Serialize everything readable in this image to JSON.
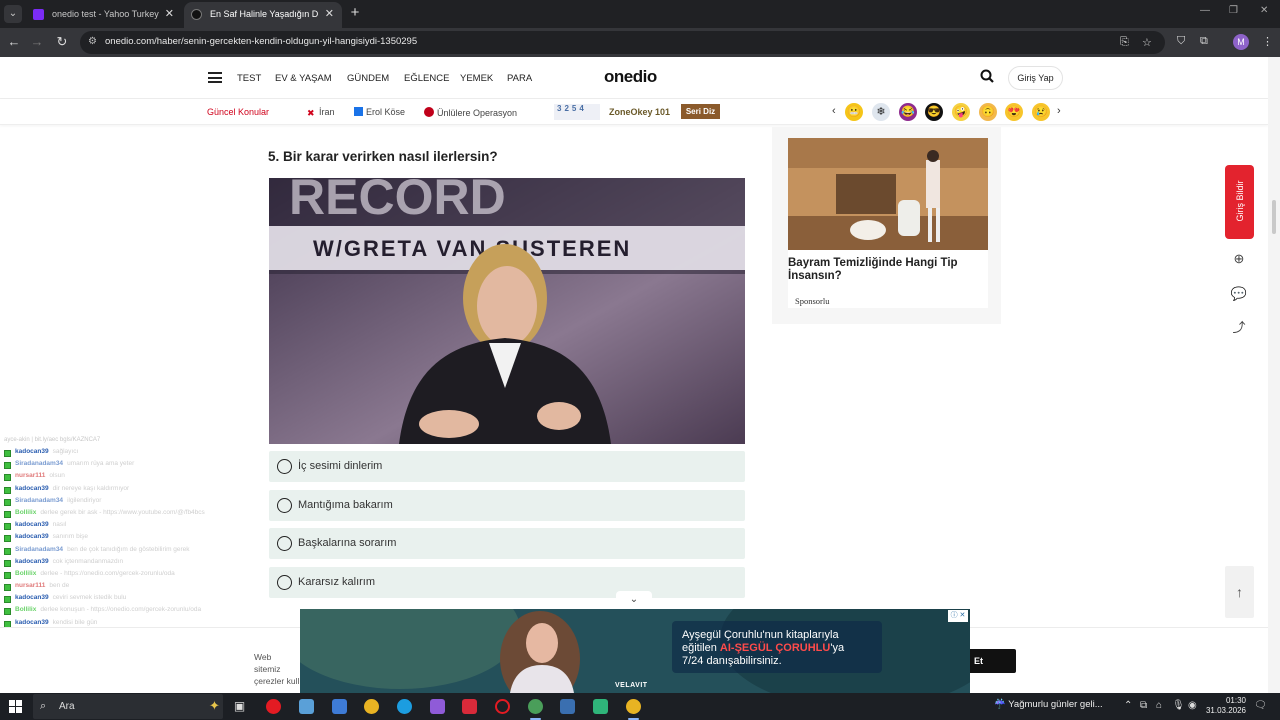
{
  "browser": {
    "tabs": [
      {
        "title": "onedio test - Yahoo Turkey Ara",
        "active": false
      },
      {
        "title": "En Saf Halinle Yaşadığın Dönem",
        "active": true
      }
    ],
    "url": "onedio.com/haber/senin-gercekten-kendin-oldugun-yil-hangisiydi-1350295",
    "profile_initial": "M"
  },
  "site": {
    "logo": "onedio",
    "nav": [
      "TEST",
      "EV & YAŞAM",
      "GÜNDEM",
      "EĞLENCE",
      "YEMEK",
      "PARA"
    ],
    "login": "Giriş Yap",
    "topics_label": "Güncel Konular",
    "topics": [
      {
        "label": "İran",
        "color": "#d0021b"
      },
      {
        "label": "Erol Köse",
        "color": "#1a73e8"
      },
      {
        "label": "Ünlülere Operasyon",
        "color": "#c0001a"
      }
    ],
    "zone_numbers": "3254",
    "zone_title": "ZoneOkey 101",
    "seri_diz": "Seri Diz",
    "emojis": [
      "😬",
      "❄",
      "😂",
      "😎",
      "🤪",
      "🙃",
      "😍",
      "😢"
    ]
  },
  "article": {
    "question": "5. Bir karar verirken nasıl ilerlersin?",
    "image_caption": "W/GRETA VAN SUSTEREN",
    "image_banner": "RECORD",
    "options": [
      "İç sesimi dinlerim",
      "Mantığıma bakarım",
      "Başkalarına sorarım",
      "Kararsız kalırım"
    ]
  },
  "sidebar_ad": {
    "title": "Bayram Temizliğinde Hangi Tip İnsansın?",
    "sponsor": "Sponsorlu"
  },
  "floating": {
    "giris_bildir": "Giriş Bildir"
  },
  "chat": {
    "header": "ayce-akin | bit.ly/aec bgls/KAZNCA7",
    "lines": [
      {
        "user": "kadocan39",
        "msg": "sağlayıcı",
        "color": "#2a5db0"
      },
      {
        "user": "Siradanadam34",
        "msg": "umarım rüya ama yeter",
        "color": "#7a9cd1"
      },
      {
        "user": "nursar111",
        "msg": "olsun",
        "color": "#e07a7a"
      },
      {
        "user": "kadocan39",
        "msg": "dir nereye kaşı kaldırmıyor",
        "color": "#2a5db0"
      },
      {
        "user": "Siradanadam34",
        "msg": "ilgilendiriyor",
        "color": "#7a9cd1"
      },
      {
        "user": "Bollilix",
        "msg": "derlee gerek bir ask - https://www.youtube.com/@/fb4bcs",
        "color": "#6ad36a"
      },
      {
        "user": "kadocan39",
        "msg": "nasıl",
        "color": "#2a5db0"
      },
      {
        "user": "kadocan39",
        "msg": "sanırım bişe",
        "color": "#2a5db0"
      },
      {
        "user": "Siradanadam34",
        "msg": "ben de çok tanıdığım de göstebilirim gerek",
        "color": "#7a9cd1"
      },
      {
        "user": "kadocan39",
        "msg": "cok içtenmandanmazdın",
        "color": "#2a5db0"
      },
      {
        "user": "Bollilix",
        "msg": "derlee - https://onedio.com/gercek-zorunlu/oda",
        "color": "#6ad36a"
      },
      {
        "user": "nursar111",
        "msg": "ben de",
        "color": "#e07a7a"
      },
      {
        "user": "kadocan39",
        "msg": "ceviri sevmek istedik bulu",
        "color": "#2a5db0"
      },
      {
        "user": "Bollilix",
        "msg": "derlee konuşun - https://onedio.com/gercek-zorunlu/oda",
        "color": "#6ad36a"
      },
      {
        "user": "kadocan39",
        "msg": "kendisi bile gün",
        "color": "#2a5db0"
      },
      {
        "user": "kadocan39",
        "msg": "güzellik",
        "color": "#2a5db0"
      },
      {
        "user": "nursar111",
        "msg": "güzel",
        "color": "#e07a7a"
      },
      {
        "user": "nursar111",
        "msg": "mantık",
        "color": "#e07a7a"
      }
    ]
  },
  "cookie": {
    "text": "Web sitemiz çerezler kull",
    "button": "Et"
  },
  "bottom_ad": {
    "line1": "Ayşegül Çoruhlu'nun kitaplarıyla",
    "line2_pre": "eğitilen ",
    "line2_hl": "AI-ŞEGÜL ÇORUHLU",
    "line2_post": "'ya",
    "line3": "7/24 danışabilirsiniz.",
    "brand": "VELAVIT"
  },
  "taskbar": {
    "search": "Ara",
    "weather": "Yağmurlu günler geli...",
    "time": "01:30",
    "date": "31.03.2026"
  },
  "colors": {
    "accent_red": "#e3232e",
    "option_bg": "#e9f1ee"
  }
}
